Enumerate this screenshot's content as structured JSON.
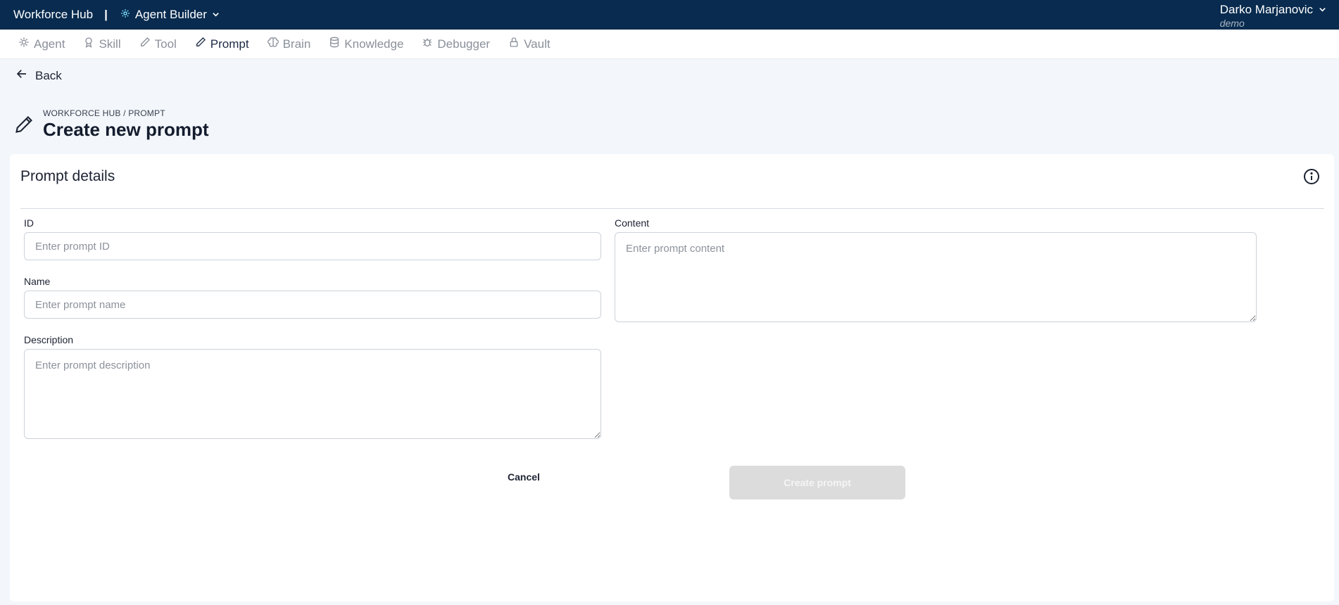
{
  "topbar": {
    "app_name": "Workforce Hub",
    "separator": "|",
    "module": "Agent Builder",
    "user_name": "Darko Marjanovic",
    "org": "demo"
  },
  "nav": {
    "tabs": [
      {
        "label": "Agent",
        "icon": "agent-icon",
        "active": false
      },
      {
        "label": "Skill",
        "icon": "award-icon",
        "active": false
      },
      {
        "label": "Tool",
        "icon": "pencil-ruler-icon",
        "active": false
      },
      {
        "label": "Prompt",
        "icon": "pencil-icon",
        "active": true
      },
      {
        "label": "Brain",
        "icon": "brain-icon",
        "active": false
      },
      {
        "label": "Knowledge",
        "icon": "database-icon",
        "active": false
      },
      {
        "label": "Debugger",
        "icon": "bug-icon",
        "active": false
      },
      {
        "label": "Vault",
        "icon": "lock-icon",
        "active": false
      }
    ]
  },
  "back_label": "Back",
  "header": {
    "breadcrumb": "WORKFORCE HUB / PROMPT",
    "title": "Create new prompt"
  },
  "card": {
    "title": "Prompt details",
    "fields": {
      "id": {
        "label": "ID",
        "placeholder": "Enter prompt ID",
        "value": ""
      },
      "name": {
        "label": "Name",
        "placeholder": "Enter prompt name",
        "value": ""
      },
      "description": {
        "label": "Description",
        "placeholder": "Enter prompt description",
        "value": ""
      },
      "content": {
        "label": "Content",
        "placeholder": "Enter prompt content",
        "value": ""
      }
    },
    "cancel_label": "Cancel",
    "create_label": "Create prompt"
  },
  "colors": {
    "topbar_bg": "#082b4f",
    "page_bg": "#f3f7fb",
    "disabled_button_bg": "#dcdcdc",
    "active_tab": "#1c2a44",
    "inactive_tab": "#8a909a"
  }
}
